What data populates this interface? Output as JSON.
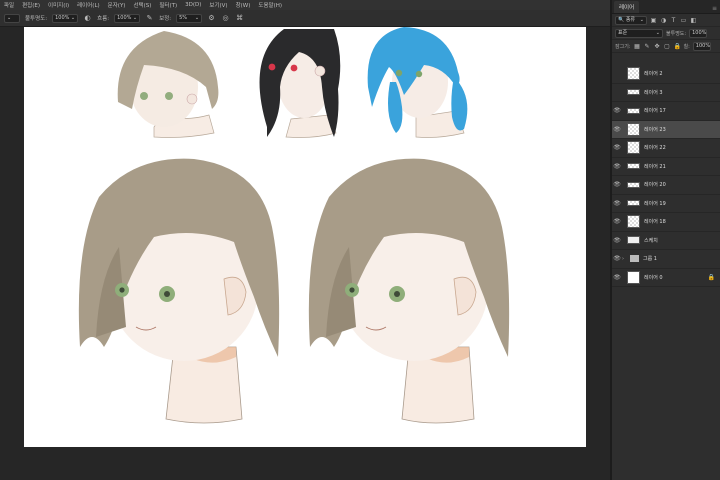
{
  "menu": [
    "파일",
    "편집(E)",
    "이미지(I)",
    "레이어(L)",
    "문자(Y)",
    "선택(S)",
    "필터(T)",
    "3D(D)",
    "보기(V)",
    "창(W)",
    "도움말(H)"
  ],
  "options": {
    "opacity_label": "불투명도:",
    "opacity_value": "100%",
    "flow_label": "흐름:",
    "flow_value": "100%",
    "smoothing_label": "보정:",
    "smoothing_value": "5%"
  },
  "panel": {
    "tab": "레이어",
    "filter_value": "종류",
    "blend_mode": "표준",
    "opacity_label": "불투명도:",
    "opacity_value": "100%",
    "lock_label": "잠그기:",
    "fill_label": "칠:",
    "fill_value": "100%"
  },
  "layers": [
    {
      "name": "레이어 2",
      "visible": false,
      "thumb": "checker"
    },
    {
      "name": "레이어 3",
      "visible": false,
      "thumb": "wide"
    },
    {
      "name": "레이어 17",
      "visible": true,
      "thumb": "line"
    },
    {
      "name": "레이어 23",
      "visible": true,
      "thumb": "checker",
      "selected": true
    },
    {
      "name": "레이어 22",
      "visible": true,
      "thumb": "checker"
    },
    {
      "name": "레이어 21",
      "visible": true,
      "thumb": "line"
    },
    {
      "name": "레이어 20",
      "visible": true,
      "thumb": "line"
    },
    {
      "name": "레이어 19",
      "visible": true,
      "thumb": "wide"
    },
    {
      "name": "레이어 18",
      "visible": true,
      "thumb": "checker"
    },
    {
      "name": "스케치",
      "visible": true,
      "thumb": "text"
    },
    {
      "name": "그룹 1",
      "visible": true,
      "thumb": "folder"
    },
    {
      "name": "레이어 0",
      "visible": true,
      "thumb": "white",
      "locked": true
    }
  ],
  "colors": {
    "hair_brown": "#a89c88",
    "hair_black": "#2a2a2c",
    "hair_blue": "#3aa3dc",
    "skin": "#f7e8dc",
    "eye_green": "#8fae7a",
    "eye_red": "#d8364a"
  }
}
